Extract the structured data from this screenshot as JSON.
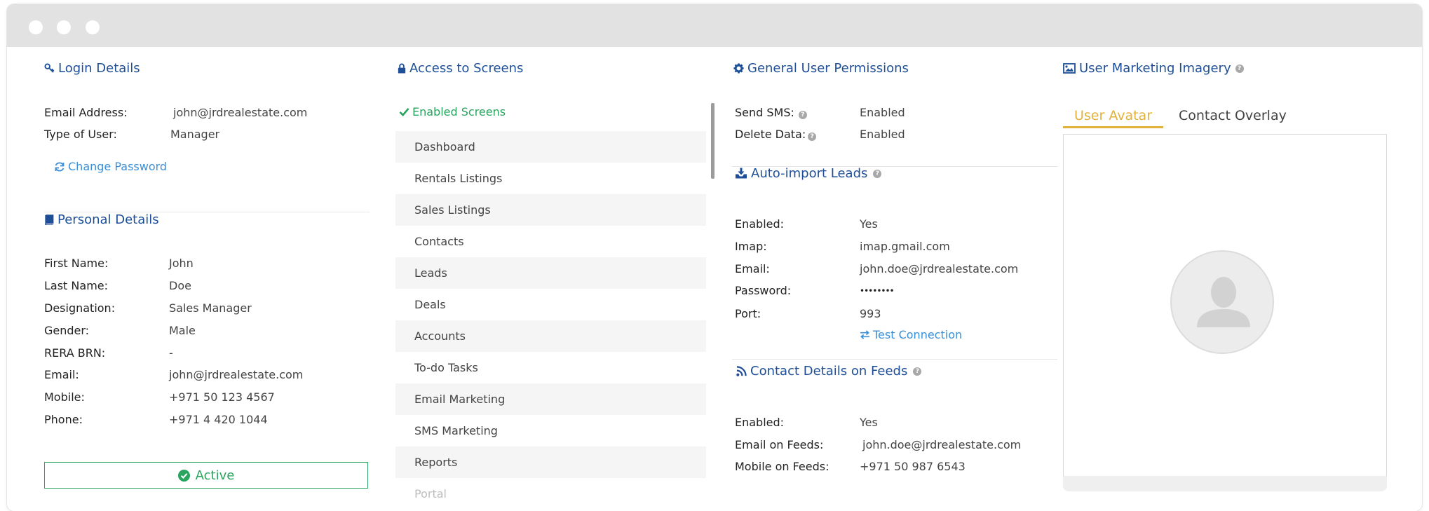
{
  "login": {
    "title": "Login Details",
    "email_label": "Email Address:",
    "email_value": "john@jrdrealestate.com",
    "type_label": "Type of User:",
    "type_value": "Manager",
    "change_password": "Change Password"
  },
  "personal": {
    "title": "Personal Details",
    "fields": [
      {
        "label": "First Name:",
        "value": "John"
      },
      {
        "label": "Last Name:",
        "value": "Doe"
      },
      {
        "label": "Designation:",
        "value": "Sales Manager"
      },
      {
        "label": "Gender:",
        "value": "Male"
      },
      {
        "label": "RERA BRN:",
        "value": "-"
      },
      {
        "label": "Email:",
        "value": "john@jrdrealestate.com"
      },
      {
        "label": "Mobile:",
        "value": "+971 50 123 4567"
      },
      {
        "label": "Phone:",
        "value": "+971 4 420 1044"
      }
    ],
    "status": "Active"
  },
  "access": {
    "title": "Access to Screens",
    "enabled_label": "Enabled Screens",
    "screens": [
      "Dashboard",
      "Rentals Listings",
      "Sales Listings",
      "Contacts",
      "Leads",
      "Deals",
      "Accounts",
      "To-do Tasks",
      "Email Marketing",
      "SMS Marketing",
      "Reports",
      "Portal"
    ]
  },
  "permissions": {
    "title": "General User Permissions",
    "send_sms_label": "Send SMS:",
    "send_sms_value": "Enabled",
    "delete_data_label": "Delete Data:",
    "delete_data_value": "Enabled"
  },
  "auto_import": {
    "title": "Auto-import Leads",
    "fields": [
      {
        "label": "Enabled:",
        "value": "Yes"
      },
      {
        "label": "Imap:",
        "value": "imap.gmail.com"
      },
      {
        "label": "Email:",
        "value": "john.doe@jrdrealestate.com"
      },
      {
        "label": "Password:",
        "value": "••••••••"
      },
      {
        "label": "Port:",
        "value": "993"
      }
    ],
    "test_connection": "Test Connection"
  },
  "feeds": {
    "title": "Contact Details on Feeds",
    "fields": [
      {
        "label": "Enabled:",
        "value": "Yes"
      },
      {
        "label": "Email on Feeds:",
        "value": "john.doe@jrdrealestate.com"
      },
      {
        "label": "Mobile on Feeds:",
        "value": "+971 50 987 6543"
      }
    ]
  },
  "imagery": {
    "title": "User Marketing Imagery",
    "tabs": [
      "User Avatar",
      "Contact Overlay"
    ]
  },
  "colors": {
    "heading": "#1d4e97",
    "link": "#3a8fd6",
    "success": "#2aa45f",
    "tab_active": "#e3b23c"
  }
}
